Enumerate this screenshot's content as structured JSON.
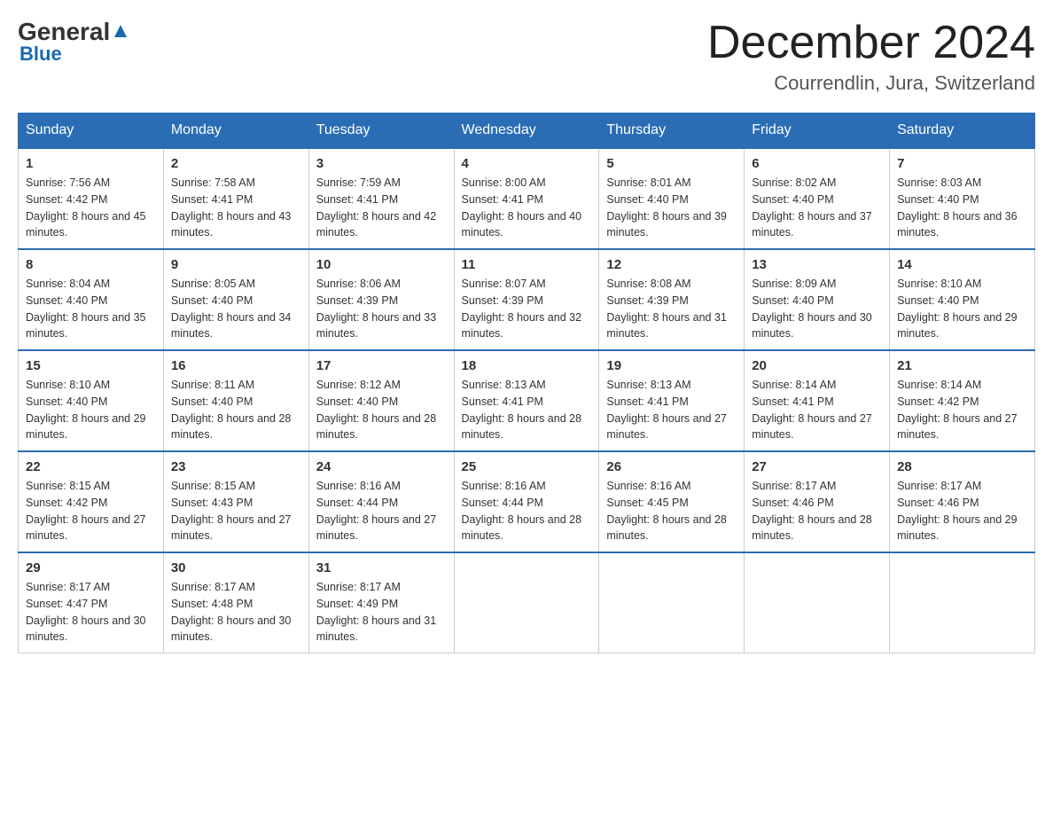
{
  "header": {
    "logo_general": "General",
    "logo_blue": "Blue",
    "month_title": "December 2024",
    "location": "Courrendlin, Jura, Switzerland"
  },
  "columns": [
    "Sunday",
    "Monday",
    "Tuesday",
    "Wednesday",
    "Thursday",
    "Friday",
    "Saturday"
  ],
  "weeks": [
    [
      {
        "day": "1",
        "sunrise": "7:56 AM",
        "sunset": "4:42 PM",
        "daylight": "8 hours and 45 minutes."
      },
      {
        "day": "2",
        "sunrise": "7:58 AM",
        "sunset": "4:41 PM",
        "daylight": "8 hours and 43 minutes."
      },
      {
        "day": "3",
        "sunrise": "7:59 AM",
        "sunset": "4:41 PM",
        "daylight": "8 hours and 42 minutes."
      },
      {
        "day": "4",
        "sunrise": "8:00 AM",
        "sunset": "4:41 PM",
        "daylight": "8 hours and 40 minutes."
      },
      {
        "day": "5",
        "sunrise": "8:01 AM",
        "sunset": "4:40 PM",
        "daylight": "8 hours and 39 minutes."
      },
      {
        "day": "6",
        "sunrise": "8:02 AM",
        "sunset": "4:40 PM",
        "daylight": "8 hours and 37 minutes."
      },
      {
        "day": "7",
        "sunrise": "8:03 AM",
        "sunset": "4:40 PM",
        "daylight": "8 hours and 36 minutes."
      }
    ],
    [
      {
        "day": "8",
        "sunrise": "8:04 AM",
        "sunset": "4:40 PM",
        "daylight": "8 hours and 35 minutes."
      },
      {
        "day": "9",
        "sunrise": "8:05 AM",
        "sunset": "4:40 PM",
        "daylight": "8 hours and 34 minutes."
      },
      {
        "day": "10",
        "sunrise": "8:06 AM",
        "sunset": "4:39 PM",
        "daylight": "8 hours and 33 minutes."
      },
      {
        "day": "11",
        "sunrise": "8:07 AM",
        "sunset": "4:39 PM",
        "daylight": "8 hours and 32 minutes."
      },
      {
        "day": "12",
        "sunrise": "8:08 AM",
        "sunset": "4:39 PM",
        "daylight": "8 hours and 31 minutes."
      },
      {
        "day": "13",
        "sunrise": "8:09 AM",
        "sunset": "4:40 PM",
        "daylight": "8 hours and 30 minutes."
      },
      {
        "day": "14",
        "sunrise": "8:10 AM",
        "sunset": "4:40 PM",
        "daylight": "8 hours and 29 minutes."
      }
    ],
    [
      {
        "day": "15",
        "sunrise": "8:10 AM",
        "sunset": "4:40 PM",
        "daylight": "8 hours and 29 minutes."
      },
      {
        "day": "16",
        "sunrise": "8:11 AM",
        "sunset": "4:40 PM",
        "daylight": "8 hours and 28 minutes."
      },
      {
        "day": "17",
        "sunrise": "8:12 AM",
        "sunset": "4:40 PM",
        "daylight": "8 hours and 28 minutes."
      },
      {
        "day": "18",
        "sunrise": "8:13 AM",
        "sunset": "4:41 PM",
        "daylight": "8 hours and 28 minutes."
      },
      {
        "day": "19",
        "sunrise": "8:13 AM",
        "sunset": "4:41 PM",
        "daylight": "8 hours and 27 minutes."
      },
      {
        "day": "20",
        "sunrise": "8:14 AM",
        "sunset": "4:41 PM",
        "daylight": "8 hours and 27 minutes."
      },
      {
        "day": "21",
        "sunrise": "8:14 AM",
        "sunset": "4:42 PM",
        "daylight": "8 hours and 27 minutes."
      }
    ],
    [
      {
        "day": "22",
        "sunrise": "8:15 AM",
        "sunset": "4:42 PM",
        "daylight": "8 hours and 27 minutes."
      },
      {
        "day": "23",
        "sunrise": "8:15 AM",
        "sunset": "4:43 PM",
        "daylight": "8 hours and 27 minutes."
      },
      {
        "day": "24",
        "sunrise": "8:16 AM",
        "sunset": "4:44 PM",
        "daylight": "8 hours and 27 minutes."
      },
      {
        "day": "25",
        "sunrise": "8:16 AM",
        "sunset": "4:44 PM",
        "daylight": "8 hours and 28 minutes."
      },
      {
        "day": "26",
        "sunrise": "8:16 AM",
        "sunset": "4:45 PM",
        "daylight": "8 hours and 28 minutes."
      },
      {
        "day": "27",
        "sunrise": "8:17 AM",
        "sunset": "4:46 PM",
        "daylight": "8 hours and 28 minutes."
      },
      {
        "day": "28",
        "sunrise": "8:17 AM",
        "sunset": "4:46 PM",
        "daylight": "8 hours and 29 minutes."
      }
    ],
    [
      {
        "day": "29",
        "sunrise": "8:17 AM",
        "sunset": "4:47 PM",
        "daylight": "8 hours and 30 minutes."
      },
      {
        "day": "30",
        "sunrise": "8:17 AM",
        "sunset": "4:48 PM",
        "daylight": "8 hours and 30 minutes."
      },
      {
        "day": "31",
        "sunrise": "8:17 AM",
        "sunset": "4:49 PM",
        "daylight": "8 hours and 31 minutes."
      },
      null,
      null,
      null,
      null
    ]
  ]
}
